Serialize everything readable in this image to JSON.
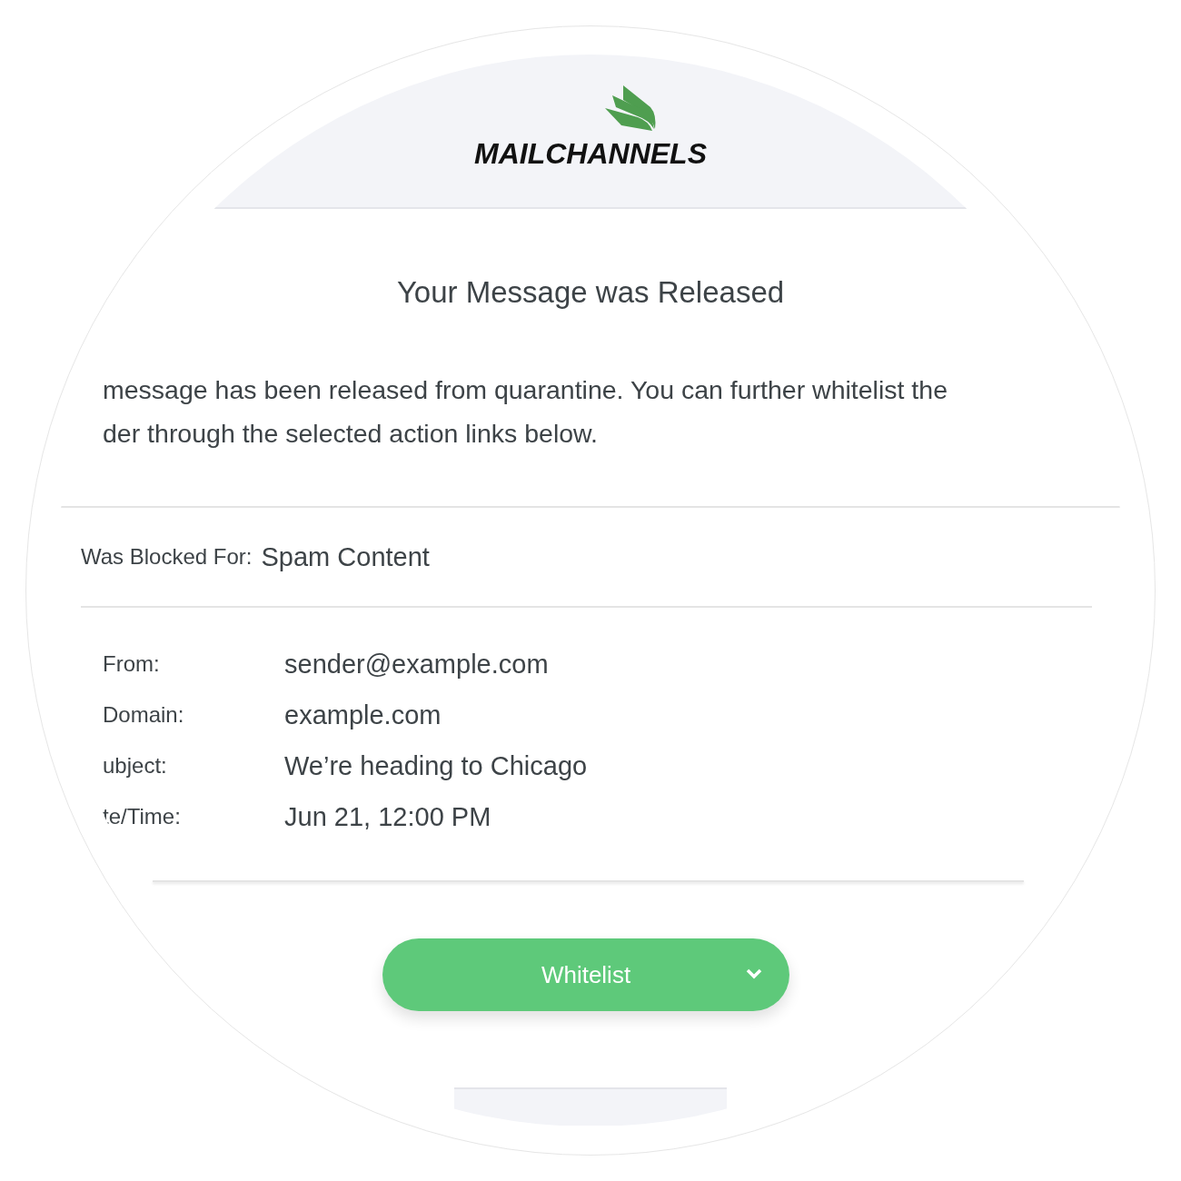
{
  "header": {
    "logo_text": "MAILCHANNELS"
  },
  "title": "Your Message was Released",
  "message_lines": [
    "message has been released from quarantine. You can further whitelist the",
    "der through the selected action links below."
  ],
  "blocked": {
    "label": "Was Blocked For:",
    "value": "Spam Content"
  },
  "details": [
    {
      "label": "From:",
      "value": "sender@example.com"
    },
    {
      "label": "Domain:",
      "value": "example.com"
    },
    {
      "label": "ubject:",
      "value": "We’re heading to Chicago"
    },
    {
      "label": "te/Time:",
      "value": "Jun 21, 12:00 PM"
    }
  ],
  "button": {
    "label": "Whitelist"
  }
}
